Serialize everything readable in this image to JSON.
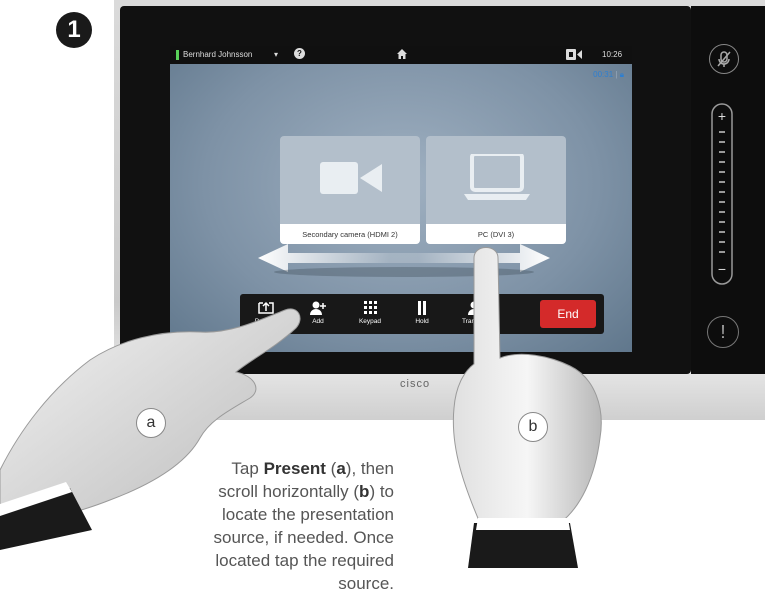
{
  "step": {
    "number": "1"
  },
  "device": {
    "brand": "cisco",
    "status_bar": {
      "caller": "Bernhard Johnsson",
      "clock": "10:26"
    },
    "call_timer": "00:31",
    "sources": [
      {
        "label": "Secondary camera (HDMI 2)",
        "icon": "video-camera-icon"
      },
      {
        "label": "PC (DVI 3)",
        "icon": "laptop-icon"
      }
    ],
    "toolbar": {
      "present": "Present",
      "add": "Add",
      "keypad": "Keypad",
      "hold": "Hold",
      "transfer": "Transfer",
      "end": "End"
    },
    "volume": {
      "plus": "+",
      "minus": "−"
    },
    "alert": "!"
  },
  "instruction": {
    "part1": "Tap ",
    "present_bold": "Present",
    "part2": " (",
    "a_bold": "a",
    "part3": "), then scroll horizontally (",
    "b_bold": "b",
    "part4": ") to locate the presentation source, if needed. Once located tap the required source."
  },
  "callouts": {
    "a": "a",
    "b": "b"
  },
  "colors": {
    "end_button": "#d42a2a",
    "timer": "#2e7fd1",
    "caller_indicator": "#5ad15a"
  }
}
